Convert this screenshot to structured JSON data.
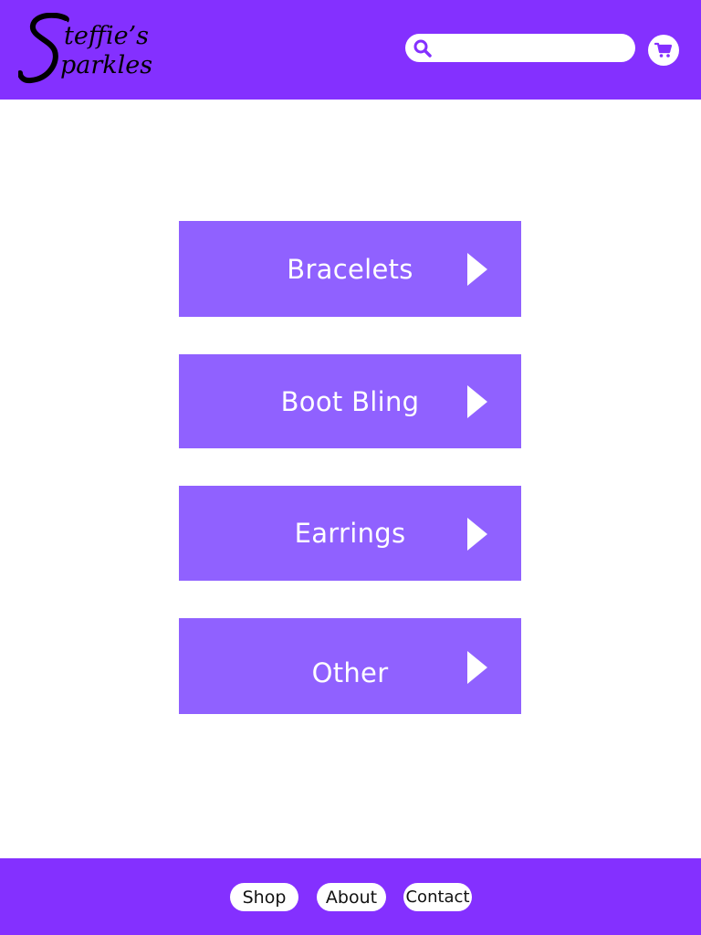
{
  "brand": {
    "logo_text": "Steffie's Sparkles",
    "primary_color": "#8430ff",
    "tile_color": "#9061ff"
  },
  "header": {
    "search": {
      "placeholder": "",
      "value": "",
      "icon": "search-icon"
    },
    "cart": {
      "icon": "cart-icon"
    }
  },
  "categories": [
    {
      "label": "Bracelets",
      "icon": "play-arrow-icon"
    },
    {
      "label": "Boot Bling",
      "icon": "play-arrow-icon"
    },
    {
      "label": "Earrings",
      "icon": "play-arrow-icon"
    },
    {
      "label": "Other",
      "icon": "play-arrow-icon"
    }
  ],
  "footer": {
    "links": [
      {
        "label": "Shop"
      },
      {
        "label": "About"
      },
      {
        "label": "Contact"
      }
    ]
  }
}
